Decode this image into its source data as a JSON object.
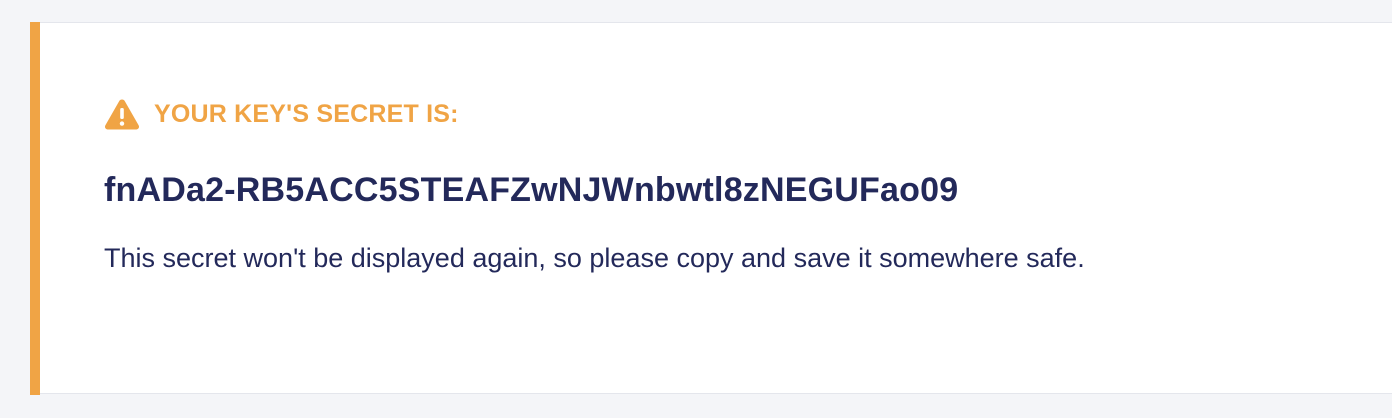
{
  "alert": {
    "icon": "warning-icon",
    "label": "YOUR KEY'S SECRET IS:",
    "secret": "fnADa2-RB5ACC5STEAFZwNJWnbwtl8zNEGUFao09",
    "note": "This secret won't be displayed again, so please copy and save it somewhere safe.",
    "accent_color": "#f0a445",
    "text_color": "#23295a"
  }
}
